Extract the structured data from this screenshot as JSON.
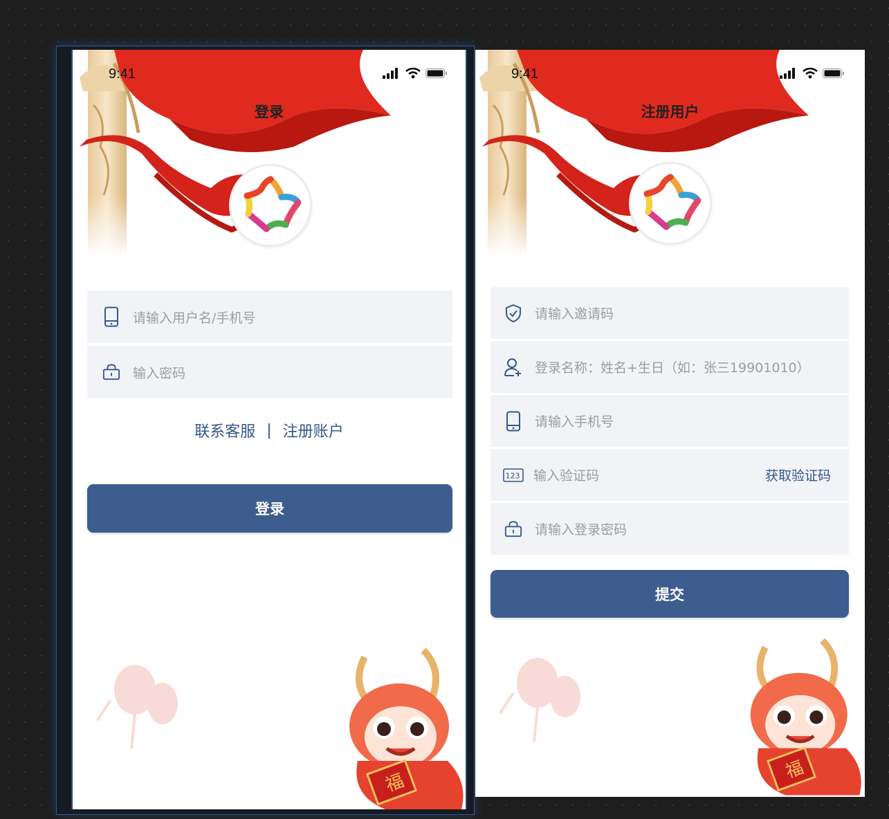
{
  "status_bar": {
    "time": "9:41"
  },
  "login": {
    "title": "登录",
    "username_placeholder": "请输入用户名/手机号",
    "password_placeholder": "输入密码",
    "contact_link": "联系客服",
    "separator": "|",
    "register_link": "注册账户",
    "submit_label": "登录"
  },
  "register": {
    "title": "注册用户",
    "invite_placeholder": "请输入邀请码",
    "name_placeholder": "登录名称：姓名+生日（如：张三19901010）",
    "phone_placeholder": "请输入手机号",
    "code_placeholder": "输入验证码",
    "get_code_label": "获取验证码",
    "code_icon_text": "123",
    "password_placeholder": "请输入登录密码",
    "submit_label": "提交"
  },
  "dragon_badge": "福",
  "icons": {
    "signal": "cellular-signal-icon",
    "wifi": "wifi-icon",
    "battery": "battery-icon",
    "phone": "mobile-phone-icon",
    "lock": "lock-icon",
    "shield": "shield-check-icon",
    "user": "user-add-icon",
    "code": "number-code-icon"
  },
  "colors": {
    "primary": "#3d5d8e",
    "link": "#34588a",
    "field_bg": "#f2f3f6",
    "placeholder": "#9a9da3",
    "flag_red": "#e02a1f"
  }
}
